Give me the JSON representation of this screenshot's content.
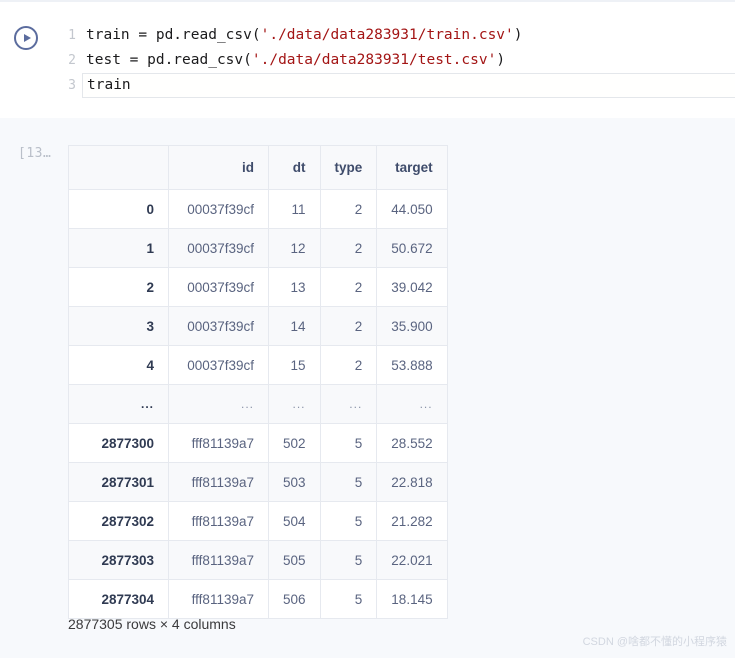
{
  "code_cell": {
    "run_button_icon": "play-circle-icon",
    "lines": [
      {
        "number": "1",
        "prefix": "train = pd.read_csv(",
        "string": "'./data/data283931/train.csv'",
        "suffix": ")",
        "active": false
      },
      {
        "number": "2",
        "prefix": "test = pd.read_csv(",
        "string": "'./data/data283931/test.csv'",
        "suffix": ")",
        "active": false
      },
      {
        "number": "3",
        "prefix": "train",
        "string": "",
        "suffix": "",
        "active": true
      }
    ]
  },
  "output": {
    "prompt": "[13…",
    "dataframe": {
      "columns": [
        "",
        "id",
        "dt",
        "type",
        "target"
      ],
      "rows": [
        {
          "index": "0",
          "id": "00037f39cf",
          "dt": "11",
          "type": "2",
          "target": "44.050"
        },
        {
          "index": "1",
          "id": "00037f39cf",
          "dt": "12",
          "type": "2",
          "target": "50.672"
        },
        {
          "index": "2",
          "id": "00037f39cf",
          "dt": "13",
          "type": "2",
          "target": "39.042"
        },
        {
          "index": "3",
          "id": "00037f39cf",
          "dt": "14",
          "type": "2",
          "target": "35.900"
        },
        {
          "index": "4",
          "id": "00037f39cf",
          "dt": "15",
          "type": "2",
          "target": "53.888"
        },
        {
          "index": "...",
          "id": "...",
          "dt": "...",
          "type": "...",
          "target": "...",
          "is_ellipsis": true
        },
        {
          "index": "2877300",
          "id": "fff81139a7",
          "dt": "502",
          "type": "5",
          "target": "28.552"
        },
        {
          "index": "2877301",
          "id": "fff81139a7",
          "dt": "503",
          "type": "5",
          "target": "22.818"
        },
        {
          "index": "2877302",
          "id": "fff81139a7",
          "dt": "504",
          "type": "5",
          "target": "21.282"
        },
        {
          "index": "2877303",
          "id": "fff81139a7",
          "dt": "505",
          "type": "5",
          "target": "22.021"
        },
        {
          "index": "2877304",
          "id": "fff81139a7",
          "dt": "506",
          "type": "5",
          "target": "18.145"
        }
      ],
      "footer": "2877305 rows × 4 columns"
    }
  },
  "watermark": "CSDN @啥都不懂的小程序猿",
  "colors": {
    "accent": "#5b6c9e",
    "string_literal": "#a31515",
    "output_background": "#f7f9fc",
    "table_border": "#e6e9ef",
    "header_text": "#3f4c6b"
  }
}
